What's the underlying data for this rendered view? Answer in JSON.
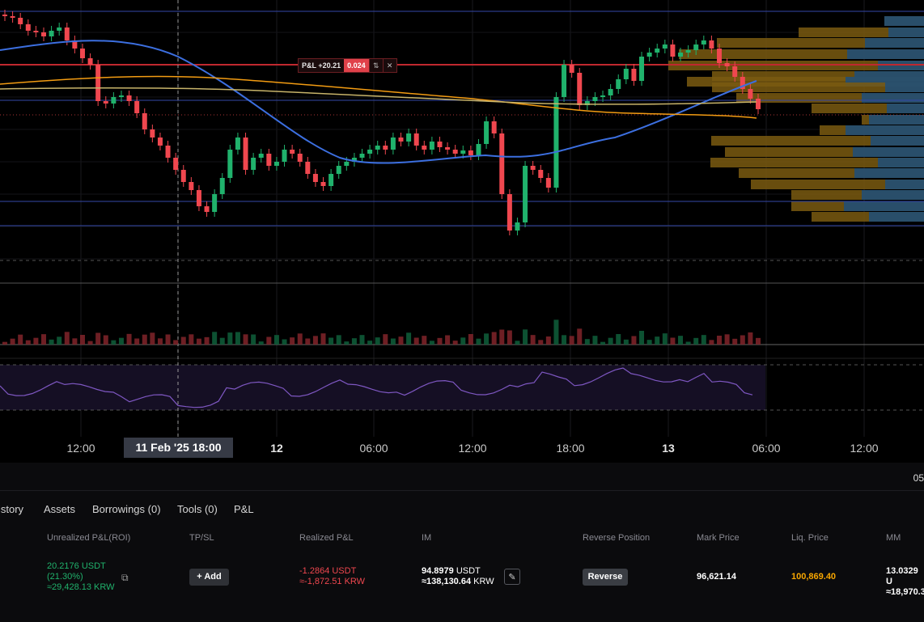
{
  "chart": {
    "pnl_label": "P&L +20.21",
    "pnl_value": "0.024",
    "swap_icon": "swap-vertical-icon",
    "close_icon": "close-icon",
    "crosshair_label": "11 Feb '25   18:00",
    "time_ticks": [
      {
        "label": "12:00",
        "bold": false
      },
      {
        "label": "12",
        "bold": true
      },
      {
        "label": "06:00",
        "bold": false
      },
      {
        "label": "12:00",
        "bold": false
      },
      {
        "label": "18:00",
        "bold": false
      },
      {
        "label": "13",
        "bold": true
      },
      {
        "label": "06:00",
        "bold": false
      },
      {
        "label": "12:00",
        "bold": false
      }
    ],
    "colors": {
      "up": "#20b26c",
      "down": "#f0474f",
      "ma_blue": "#3c6fe0",
      "ma_orange": "#f39c12",
      "ma_khaki": "#c8b46a",
      "rsi": "#7e57c2"
    }
  },
  "strip": {
    "cut_text": "05"
  },
  "tabs": [
    "istory",
    "Assets",
    "Borrowings (0)",
    "Tools (0)",
    "P&L"
  ],
  "table": {
    "headers": {
      "unrealized": "Unrealized P&L(ROI)",
      "tpsl": "TP/SL",
      "realized": "Realized P&L",
      "im": "IM",
      "reverse": "Reverse Position",
      "mark": "Mark Price",
      "liq": "Liq. Price",
      "mm": "MM"
    },
    "row": {
      "unrealized_usdt": "20.2176 USDT",
      "unrealized_roi": "(21.30%)",
      "unrealized_krw": "≈29,428.13 KRW",
      "share_icon": "external-link-icon",
      "tpsl_button": "Add",
      "realized_usdt": "-1.2864 USDT",
      "realized_krw": "≈-1,872.51 KRW",
      "im_usdt": "94.8979",
      "im_usdt_unit": "USDT",
      "im_krw": "≈138,130.64",
      "im_krw_unit": "KRW",
      "edit_icon": "edit-icon",
      "reverse_button": "Reverse",
      "mark_price": "96,621.14",
      "liq_price": "100,869.40",
      "mm_usdt": "13.0329 U",
      "mm_krw": "≈18,970.3"
    }
  }
}
